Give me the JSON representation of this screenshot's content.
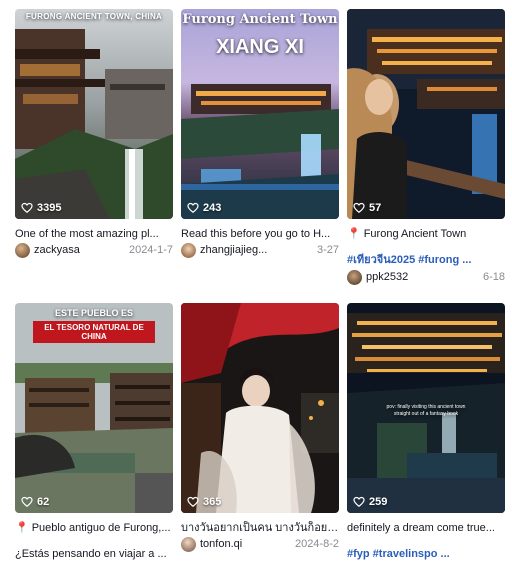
{
  "cards": [
    {
      "likes": "3395",
      "overlay": "FURONG ANCIENT TOWN, CHINA",
      "title": "One of the most amazing pl...",
      "user": "zackyasa",
      "date": "2024-1-7"
    },
    {
      "likes": "243",
      "overlay_top": "Furong Ancient Town",
      "overlay_main": "XIANG XI",
      "title": "Read this before you go to H...",
      "user": "zhangjiajieg...",
      "date": "3-27"
    },
    {
      "likes": "57",
      "location_pin": "📍",
      "title": "Furong Ancient Town",
      "tags": "#เที่ยวจีน2025 #furong ...",
      "user": "ppk2532",
      "date": "6-18"
    },
    {
      "likes": "62",
      "overlay_top": "ESTE PUEBLO ES",
      "overlay_main": "EL TESORO NATURAL DE CHINA",
      "location_pin": "📍",
      "title": "Pueblo antiguo de Furong,...",
      "subtitle": "¿Estás pensando en viajar a ..."
    },
    {
      "likes": "365",
      "title": "บางวันอยากเป็นคน บางวันก็อยา...",
      "user": "tonfon.qi",
      "date": "2024-8-2"
    },
    {
      "likes": "259",
      "overlay": "pov: finally visiting this ancient town straight out of a fantasy book",
      "title": "definitely a dream come true...",
      "tags": "#fyp #travelinspo ..."
    }
  ],
  "icons": {
    "like": "heart-outline-icon",
    "location": "location-pin-icon"
  },
  "colors": {
    "tag_blue": "#2b5db9",
    "date_gray": "#8a8b91",
    "pin_red": "#e0245e"
  }
}
